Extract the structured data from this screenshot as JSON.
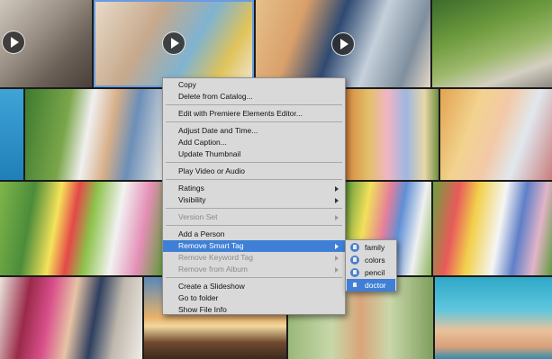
{
  "context_menu": {
    "items": [
      {
        "label": "Copy"
      },
      {
        "label": "Delete from Catalog..."
      },
      {
        "label": "Edit with Premiere Elements Editor..."
      },
      {
        "label": "Adjust Date and Time..."
      },
      {
        "label": "Add Caption..."
      },
      {
        "label": "Update Thumbnail"
      },
      {
        "label": "Play Video or Audio"
      },
      {
        "label": "Ratings",
        "submenu": true
      },
      {
        "label": "Visibility",
        "submenu": true
      },
      {
        "label": "Version Set",
        "submenu": true,
        "disabled": true
      },
      {
        "label": "Add a Person"
      },
      {
        "label": "Remove Smart Tag",
        "submenu": true,
        "highlighted": true
      },
      {
        "label": "Remove Keyword Tag",
        "submenu": true,
        "disabled": true
      },
      {
        "label": "Remove from Album",
        "submenu": true,
        "disabled": true
      },
      {
        "label": "Create a Slideshow"
      },
      {
        "label": "Go to folder"
      },
      {
        "label": "Show File Info"
      }
    ]
  },
  "smart_tag_submenu": {
    "items": [
      {
        "label": "family",
        "icon": "smart-tag-icon"
      },
      {
        "label": "colors",
        "icon": "smart-tag-icon"
      },
      {
        "label": "pencil",
        "icon": "smart-tag-icon"
      },
      {
        "label": "doctor",
        "icon": "smart-tag-icon",
        "highlighted": true
      }
    ]
  },
  "colors": {
    "menu_bg": "#d9d9d9",
    "highlight": "#3f80d6",
    "selection_border": "#6b9be0"
  }
}
